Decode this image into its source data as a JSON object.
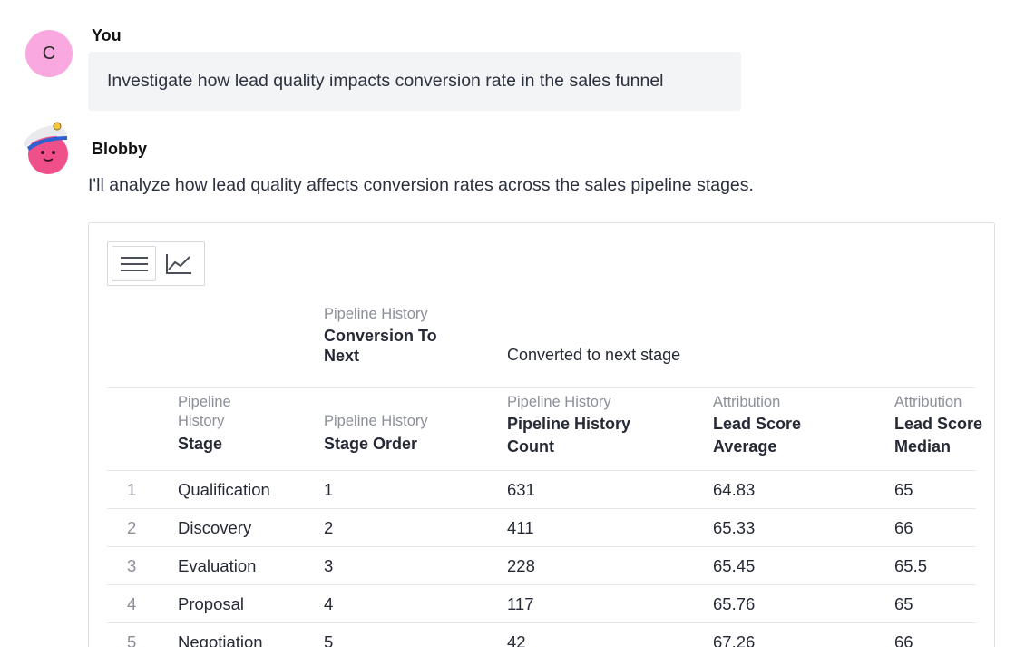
{
  "user": {
    "name": "You",
    "avatar_letter": "C",
    "message": "Investigate how lead quality impacts conversion rate in the sales funnel"
  },
  "bot": {
    "name": "Blobby",
    "message": "I'll analyze how lead quality affects conversion rates across the sales pipeline stages."
  },
  "toolbar": {
    "table_icon": "table-icon",
    "chart_icon": "line-chart-icon"
  },
  "table": {
    "pivot_header": {
      "sub": "Pipeline History",
      "main": "Conversion To Next",
      "value_label": "Converted to next stage"
    },
    "columns": [
      {
        "sub": "Pipeline History",
        "main": "Stage"
      },
      {
        "sub": "Pipeline History",
        "main": "Stage Order"
      },
      {
        "sub": "Pipeline History",
        "main": "Pipeline History Count"
      },
      {
        "sub": "Attribution",
        "main": "Lead Score Average"
      },
      {
        "sub": "Attribution",
        "main": "Lead Score Median"
      }
    ],
    "rows": [
      {
        "idx": "1",
        "stage": "Qualification",
        "order": "1",
        "count": "631",
        "avg": "64.83",
        "median": "65"
      },
      {
        "idx": "2",
        "stage": "Discovery",
        "order": "2",
        "count": "411",
        "avg": "65.33",
        "median": "66"
      },
      {
        "idx": "3",
        "stage": "Evaluation",
        "order": "3",
        "count": "228",
        "avg": "65.45",
        "median": "65.5"
      },
      {
        "idx": "4",
        "stage": "Proposal",
        "order": "4",
        "count": "117",
        "avg": "65.76",
        "median": "65"
      },
      {
        "idx": "5",
        "stage": "Negotiation",
        "order": "5",
        "count": "42",
        "avg": "67.26",
        "median": "66"
      }
    ]
  }
}
